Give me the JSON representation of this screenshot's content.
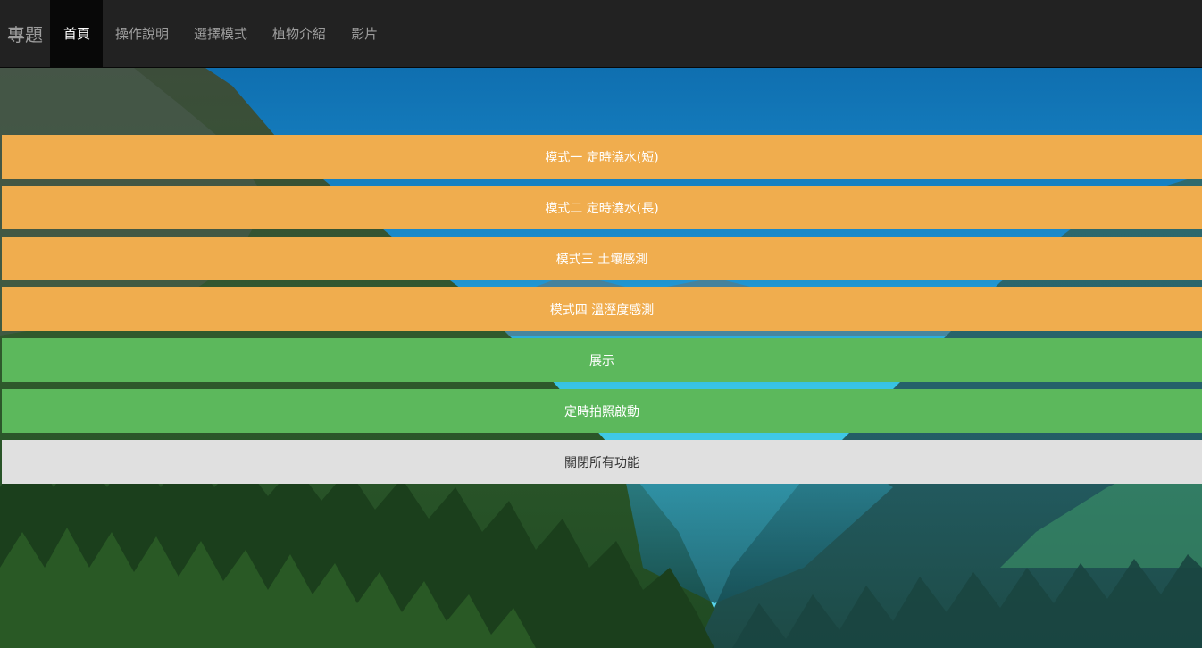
{
  "navbar": {
    "brand": "專題",
    "items": [
      {
        "label": "首頁",
        "active": true
      },
      {
        "label": "操作說明",
        "active": false
      },
      {
        "label": "選擇模式",
        "active": false
      },
      {
        "label": "植物介紹",
        "active": false
      },
      {
        "label": "影片",
        "active": false
      }
    ]
  },
  "buttons": [
    {
      "label": "模式一 定時澆水(短)",
      "style": "warning"
    },
    {
      "label": "模式二 定時澆水(長)",
      "style": "warning"
    },
    {
      "label": "模式三 土壤感測",
      "style": "warning"
    },
    {
      "label": "模式四 溫溼度感測",
      "style": "warning"
    },
    {
      "label": "展示",
      "style": "success"
    },
    {
      "label": "定時拍照啟動",
      "style": "success"
    },
    {
      "label": "關閉所有功能",
      "style": "default"
    }
  ],
  "colors": {
    "navbar_bg": "#222222",
    "nav_active_bg": "#080808",
    "warning": "#f0ad4e",
    "success": "#5cb85c",
    "default": "#e0e0e0"
  }
}
